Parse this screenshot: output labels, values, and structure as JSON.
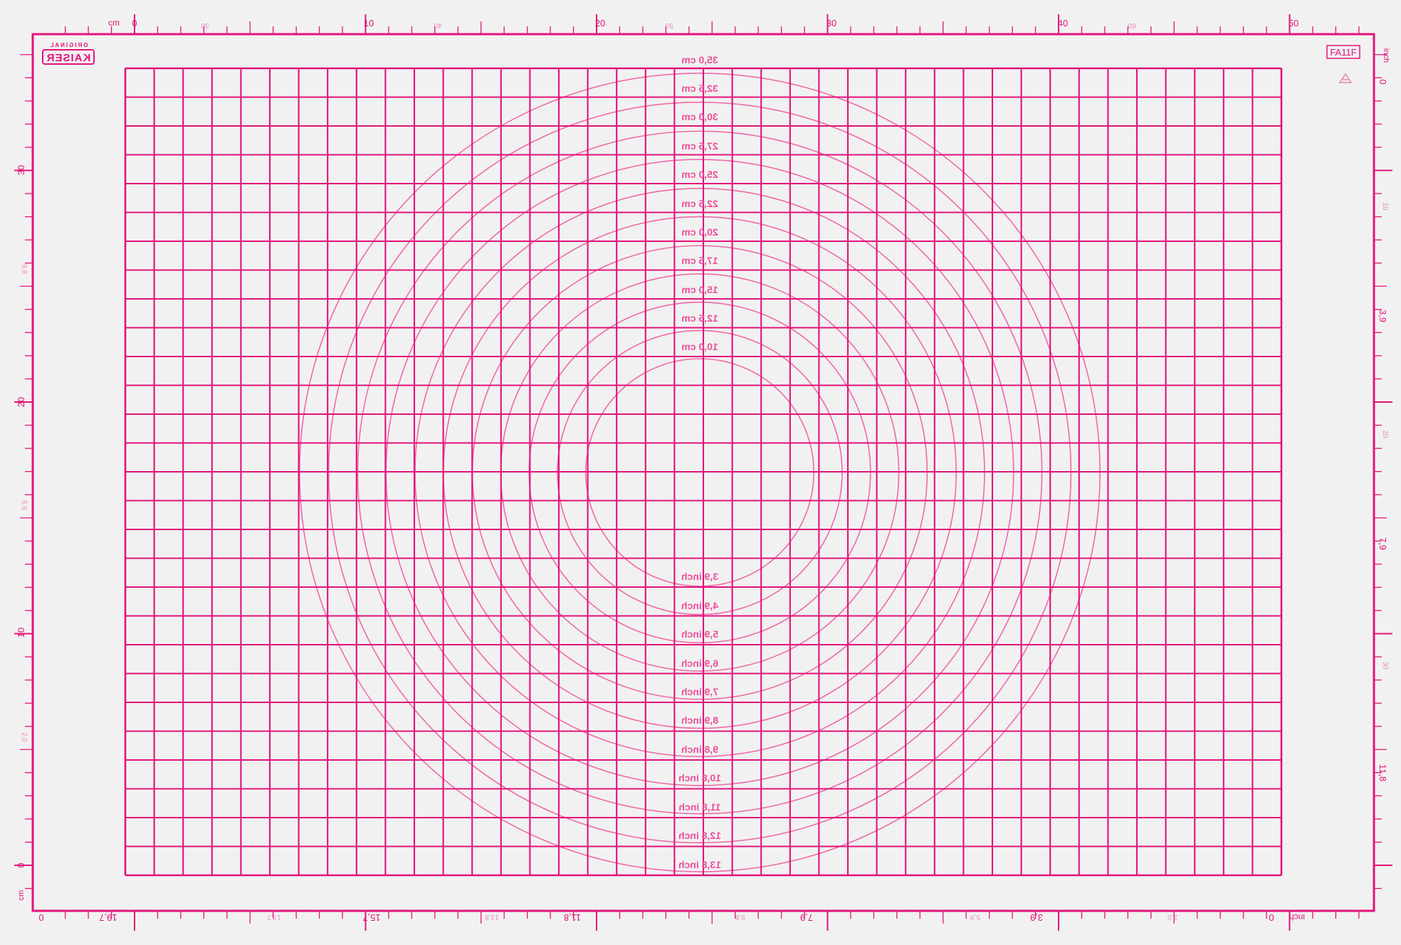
{
  "colors": {
    "background": "#ffffff",
    "mat": "#f1f1f1",
    "print": "#e2137a",
    "print_soft": "#ef6aa8"
  },
  "brand": {
    "name": "KAISER",
    "tagline": "ORIGINAL",
    "mirrored": true
  },
  "model_code": "FA11F",
  "top_ruler": {
    "unit_label": "cm",
    "labels": [
      "0",
      "10",
      "20",
      "30",
      "40",
      "50"
    ],
    "minor_labels": [
      "30",
      "40",
      "50",
      "60"
    ]
  },
  "bottom_ruler": {
    "unit_label": "inch",
    "labels": [
      "19,7",
      "15,7",
      "11,8",
      "7,9",
      "3,9",
      "0"
    ],
    "minor_labels": [
      "17,7",
      "13,8",
      "9,8",
      "5,9",
      "2,0"
    ],
    "end_label_left": "0"
  },
  "left_ruler": {
    "labels": [
      "30",
      "20",
      "10",
      "0"
    ],
    "minor_labels": [
      "9,8",
      "5,9",
      "2,0"
    ],
    "end_label": "cm"
  },
  "right_ruler": {
    "unit_label": "inch",
    "labels": [
      "0",
      "3,9",
      "7,9",
      "11,8"
    ],
    "minor_labels": [
      "10",
      "20",
      "30"
    ]
  },
  "circles_cm": [
    "35,0 cm",
    "32,5 cm",
    "30,0 cm",
    "27,5 cm",
    "25,0 cm",
    "22,5 cm",
    "20,0 cm",
    "17,5 cm",
    "15,0 cm",
    "12,5 cm",
    "10,0 cm"
  ],
  "circles_inch": [
    "3,9 inch",
    "4,9 inch",
    "5,9 inch",
    "6,9 inch",
    "7,9 inch",
    "8,9 inch",
    "9,8 inch",
    "10,8 inch",
    "11,8 inch",
    "12,8 inch",
    "13,8 inch"
  ]
}
